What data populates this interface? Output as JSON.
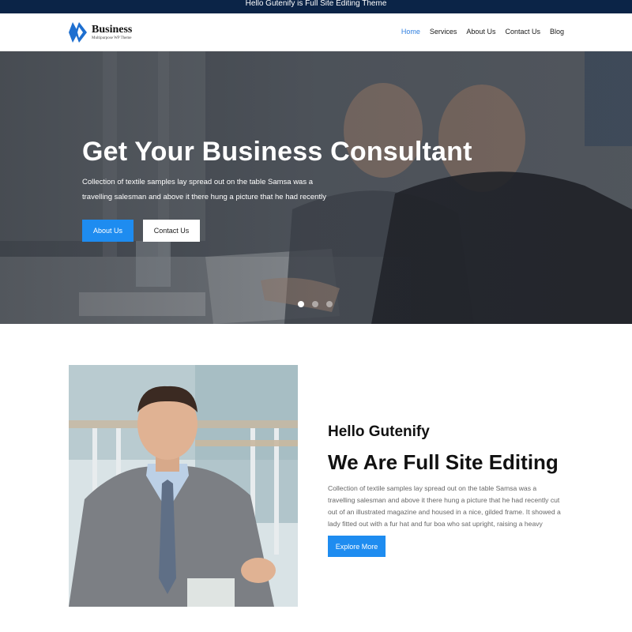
{
  "topbar": {
    "text": "Hello Gutenify is Full Site Editing Theme"
  },
  "header": {
    "logo_name": "Business",
    "logo_tagline": "Multipurpose WP Theme",
    "nav": [
      {
        "label": "Home",
        "active": true
      },
      {
        "label": "Services",
        "active": false
      },
      {
        "label": "About Us",
        "active": false
      },
      {
        "label": "Contact Us",
        "active": false
      },
      {
        "label": "Blog",
        "active": false
      }
    ]
  },
  "hero": {
    "title": "Get Your Business Consultant",
    "text": "Collection of textile samples lay spread out on the table Samsa was a travelling salesman and above it there hung a picture that he had recently",
    "primary_button": "About Us",
    "secondary_button": "Contact Us",
    "slides": 3,
    "active_slide": 1
  },
  "about": {
    "subtitle": "Hello Gutenify",
    "title": "We Are Full Site Editing",
    "text": "Collection of textile samples lay spread out on the table Samsa was a travelling salesman and above it there hung a picture that he had recently cut out of an illustrated magazine and housed in a nice, gilded frame. It showed a lady fitted out with a fur hat and fur boa who sat upright, raising a heavy",
    "button": "Explore More"
  },
  "colors": {
    "topbar": "#0b2447",
    "accent": "#1e8cf0",
    "nav_active": "#2f7fe0"
  },
  "icons": {
    "logo": "double-chevron-diamond-logo"
  }
}
